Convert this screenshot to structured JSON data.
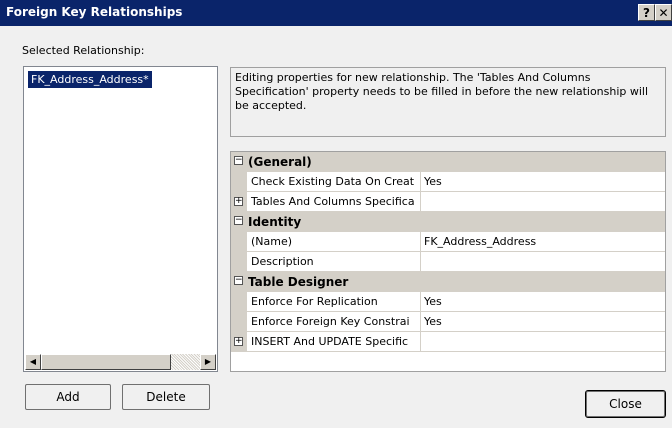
{
  "window": {
    "title": "Foreign Key Relationships",
    "help_glyph": "?",
    "close_glyph": "✕"
  },
  "relationships": {
    "label": "Selected Relationship:",
    "items": [
      "FK_Address_Address*"
    ]
  },
  "buttons": {
    "add": "Add",
    "delete": "Delete",
    "close": "Close"
  },
  "info_text": "Editing properties for new relationship.  The 'Tables And Columns Specification' property needs to be filled in before the new relationship will be accepted.",
  "properties": {
    "general": {
      "label": "(General)",
      "check_existing": {
        "name": "Check Existing Data On Creat",
        "value": "Yes"
      },
      "tables_columns": {
        "name": "Tables And Columns Specifica",
        "value": ""
      }
    },
    "identity": {
      "label": "Identity",
      "name": {
        "name": "(Name)",
        "value": "FK_Address_Address"
      },
      "description": {
        "name": "Description",
        "value": ""
      }
    },
    "table_designer": {
      "label": "Table Designer",
      "enforce_replication": {
        "name": "Enforce For Replication",
        "value": "Yes"
      },
      "enforce_fk": {
        "name": "Enforce Foreign Key Constrai",
        "value": "Yes"
      },
      "insert_update": {
        "name": "INSERT And UPDATE Specific",
        "value": ""
      }
    }
  },
  "glyphs": {
    "collapse": "−",
    "expand": "+",
    "scroll_left": "◀",
    "scroll_right": "▶"
  },
  "colors": {
    "titlebar": "#0a246a",
    "selection": "#0a246a",
    "category_bg": "#d4d0c8"
  }
}
